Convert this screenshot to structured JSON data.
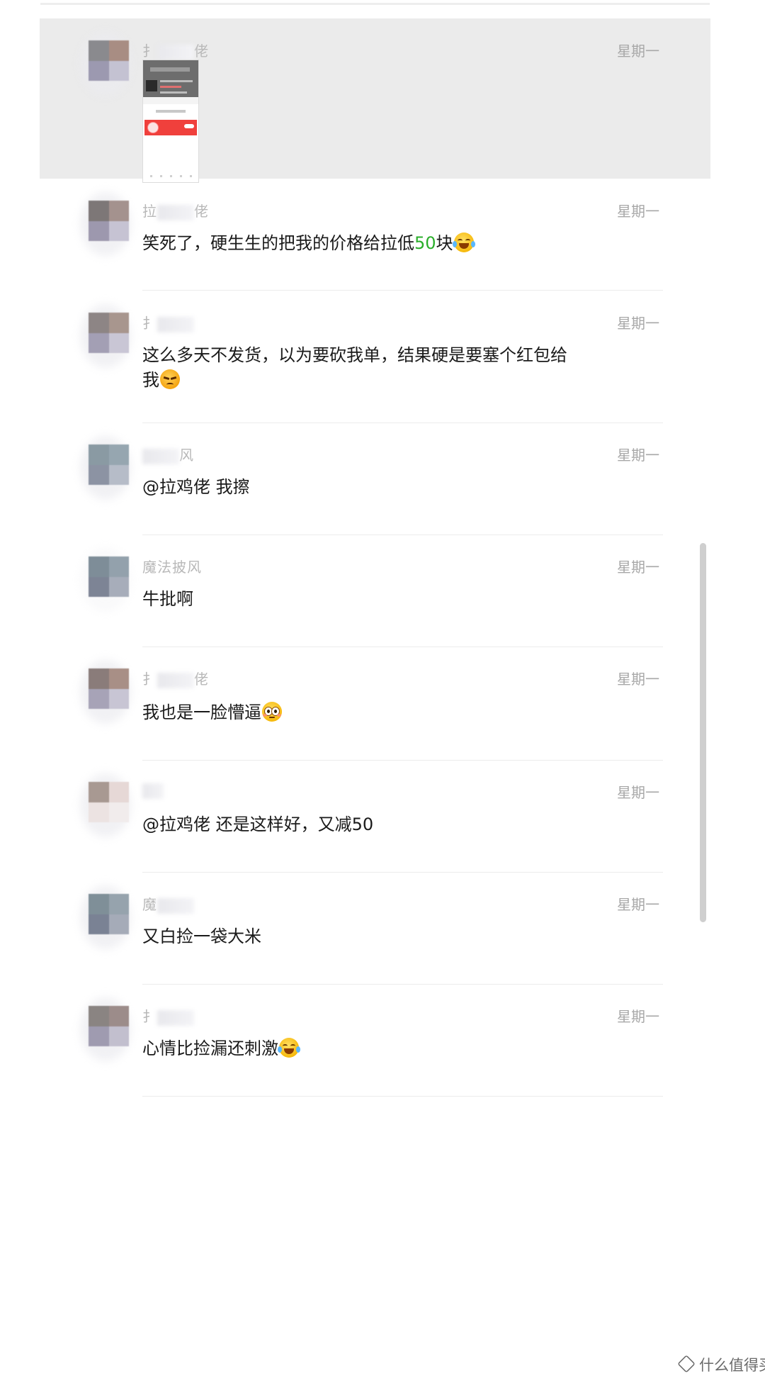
{
  "colors": {
    "highlight_bg": "#ebebeb",
    "green_number": "#2aae2a",
    "name_gray": "#b8b8b8",
    "time_gray": "#a8a8a8"
  },
  "messages": [
    {
      "name": "拉鸡佬",
      "name_visible_start": "扌",
      "name_visible_end": "佬",
      "time": "星期一",
      "type": "image",
      "highlighted": true
    },
    {
      "name_visible_start": "拉",
      "name_visible_end": "佬",
      "time": "星期一",
      "text_before": "笑死了，硬生生的把我的价格给拉低",
      "text_green": "50",
      "text_after": "块",
      "emoji": "tears-of-joy-emoji"
    },
    {
      "name_visible_start": "扌",
      "name_visible_end": "",
      "time": "星期一",
      "text": "这么多天不发货，以为要砍我单，结果硬是要塞个红包给我",
      "emoji": "angry-face-emoji"
    },
    {
      "name_visible_start": "",
      "name_visible_end": "风",
      "time": "星期一",
      "text": "@拉鸡佬 我擦"
    },
    {
      "name": "魔法披风",
      "time": "星期一",
      "text": "牛批啊"
    },
    {
      "name_visible_start": "扌",
      "name_visible_end": "佬",
      "time": "星期一",
      "text": "我也是一脸懵逼",
      "emoji": "flushed-face-emoji"
    },
    {
      "name_visible_start": "",
      "name_visible_end": "",
      "time": "星期一",
      "text": "@拉鸡佬 还是这样好，又减50"
    },
    {
      "name_visible_start": "魔",
      "name_visible_end": "",
      "time": "星期一",
      "text": "又白捡一袋大米"
    },
    {
      "name_visible_start": "扌",
      "name_visible_end": "",
      "time": "星期一",
      "text": "心情比捡漏还刺激",
      "emoji": "tears-of-joy-emoji"
    }
  ],
  "watermark": {
    "text": "什么值得买"
  }
}
